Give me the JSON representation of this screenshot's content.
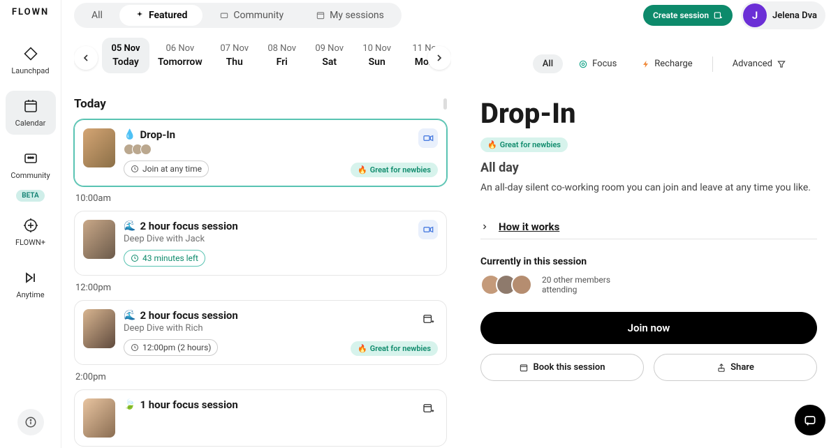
{
  "brand": "FLOWN",
  "sidebar": {
    "items": [
      {
        "label": "Launchpad"
      },
      {
        "label": "Calendar"
      },
      {
        "label": "Community"
      },
      {
        "label": "FLOWN+"
      },
      {
        "label": "Anytime"
      }
    ],
    "beta": "BETA"
  },
  "tabs": [
    {
      "label": "All"
    },
    {
      "label": "Featured"
    },
    {
      "label": "Community"
    },
    {
      "label": "My sessions"
    }
  ],
  "header": {
    "create": "Create session",
    "user_initial": "J",
    "user_name": "Jelena Dva"
  },
  "dates": [
    {
      "d": "05 Nov",
      "l": "Today"
    },
    {
      "d": "06 Nov",
      "l": "Tomorrow"
    },
    {
      "d": "07 Nov",
      "l": "Thu"
    },
    {
      "d": "08 Nov",
      "l": "Fri"
    },
    {
      "d": "09 Nov",
      "l": "Sat"
    },
    {
      "d": "10 Nov",
      "l": "Sun"
    },
    {
      "d": "11 No",
      "l": "Mon"
    }
  ],
  "filters": {
    "all": "All",
    "focus": "Focus",
    "recharge": "Recharge",
    "advanced": "Advanced"
  },
  "section_today": "Today",
  "times": {
    "t1": "10:00am",
    "t2": "12:00pm",
    "t3": "2:00pm"
  },
  "cards": {
    "dropin": {
      "title": "Drop-In",
      "join": "Join at any time",
      "newbie": "Great for newbies"
    },
    "focus1": {
      "title": "2 hour focus session",
      "sub": "Deep Dive with Jack",
      "pill": "43 minutes left"
    },
    "focus2": {
      "title": "2 hour focus session",
      "sub": "Deep Dive with Rich",
      "pill": "12:00pm  (2 hours)",
      "newbie": "Great for newbies"
    },
    "focus3": {
      "title": "1 hour focus session"
    }
  },
  "detail": {
    "title": "Drop-In",
    "newbie": "Great for newbies",
    "all_day": "All day",
    "desc": "An all-day silent co-working room you can join and leave at any time you like.",
    "how": "How it works",
    "currently": "Currently in this session",
    "attend": "20 other members attending",
    "join": "Join now",
    "book": "Book this session",
    "share": "Share"
  }
}
